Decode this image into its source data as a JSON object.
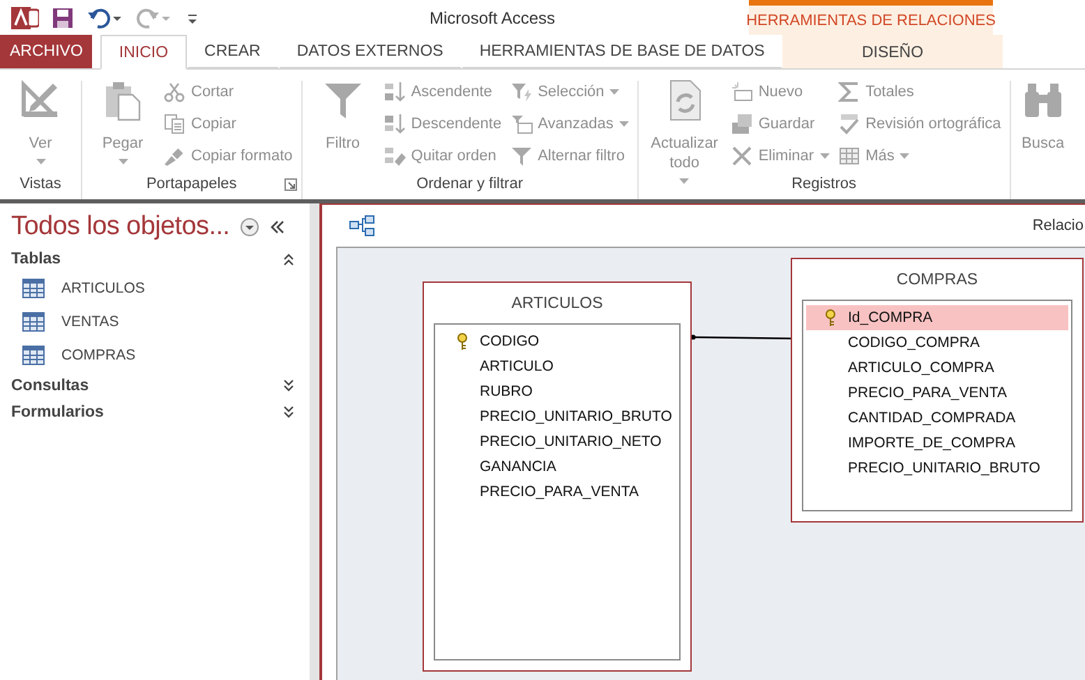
{
  "window": {
    "title": "Microsoft Access",
    "context_header": "HERRAMIENTAS DE RELACIONES"
  },
  "tabs": [
    {
      "label": "ARCHIVO",
      "kind": "file",
      "selected": false
    },
    {
      "label": "INICIO",
      "kind": "tab",
      "selected": true
    },
    {
      "label": "CREAR",
      "kind": "tab",
      "selected": false
    },
    {
      "label": "DATOS EXTERNOS",
      "kind": "tab",
      "selected": false
    },
    {
      "label": "HERRAMIENTAS DE BASE DE DATOS",
      "kind": "tab",
      "selected": false
    },
    {
      "label": "DISEÑO",
      "kind": "contextual",
      "selected": false
    }
  ],
  "ribbon": {
    "groups": [
      {
        "label": "Vistas",
        "launcher": false,
        "columns": [
          {
            "kind": "large",
            "buttons": [
              {
                "label": "Ver",
                "dropdown": true,
                "disabled": true
              }
            ]
          }
        ]
      },
      {
        "label": "Portapapeles",
        "launcher": true,
        "columns": [
          {
            "kind": "large",
            "buttons": [
              {
                "label": "Pegar",
                "dropdown": true,
                "disabled": true
              }
            ]
          },
          {
            "kind": "small",
            "buttons": [
              {
                "label": "Cortar",
                "dropdown": false,
                "disabled": true
              },
              {
                "label": "Copiar",
                "dropdown": false,
                "disabled": true
              },
              {
                "label": "Copiar formato",
                "dropdown": false,
                "disabled": true
              }
            ]
          }
        ]
      },
      {
        "label": "Ordenar y filtrar",
        "launcher": false,
        "columns": [
          {
            "kind": "large",
            "buttons": [
              {
                "label": "Filtro",
                "dropdown": false,
                "disabled": true
              }
            ]
          },
          {
            "kind": "small",
            "buttons": [
              {
                "label": "Ascendente",
                "dropdown": false,
                "disabled": true
              },
              {
                "label": "Descendente",
                "dropdown": false,
                "disabled": true
              },
              {
                "label": "Quitar orden",
                "dropdown": false,
                "disabled": true
              }
            ]
          },
          {
            "kind": "small",
            "buttons": [
              {
                "label": "Selección",
                "dropdown": true,
                "disabled": true
              },
              {
                "label": "Avanzadas",
                "dropdown": true,
                "disabled": true
              },
              {
                "label": "Alternar filtro",
                "dropdown": false,
                "disabled": true
              }
            ]
          }
        ]
      },
      {
        "label": "Registros",
        "launcher": false,
        "columns": [
          {
            "kind": "large",
            "buttons": [
              {
                "label": "Actualizar todo",
                "dropdown": true,
                "disabled": true
              }
            ]
          },
          {
            "kind": "small",
            "buttons": [
              {
                "label": "Nuevo",
                "dropdown": false,
                "disabled": true
              },
              {
                "label": "Guardar",
                "dropdown": false,
                "disabled": true
              },
              {
                "label": "Eliminar",
                "dropdown": true,
                "disabled": true
              }
            ]
          },
          {
            "kind": "small",
            "buttons": [
              {
                "label": "Totales",
                "dropdown": false,
                "disabled": true
              },
              {
                "label": "Revisión ortográfica",
                "dropdown": false,
                "disabled": true
              },
              {
                "label": "Más",
                "dropdown": true,
                "disabled": true
              }
            ]
          }
        ]
      },
      {
        "columns": [
          {
            "kind": "large",
            "buttons": [
              {
                "label": "Busca",
                "dropdown": false,
                "disabled": true
              }
            ]
          }
        ]
      }
    ]
  },
  "navigation": {
    "title": "Todos los objetos...",
    "groups": [
      {
        "label": "Tablas",
        "expanded": true,
        "items": [
          {
            "label": "ARTICULOS"
          },
          {
            "label": "VENTAS"
          },
          {
            "label": "COMPRAS"
          }
        ]
      },
      {
        "label": "Consultas",
        "expanded": false
      },
      {
        "label": "Formularios",
        "expanded": false
      }
    ]
  },
  "document": {
    "tab_label": "Relacio",
    "tables": [
      {
        "name": "ARTICULOS",
        "fields": [
          {
            "name": "CODIGO",
            "key": true,
            "selected": false
          },
          {
            "name": "ARTICULO",
            "key": false,
            "selected": false
          },
          {
            "name": "RUBRO",
            "key": false,
            "selected": false
          },
          {
            "name": "PRECIO_UNITARIO_BRUTO",
            "key": false,
            "selected": false
          },
          {
            "name": "PRECIO_UNITARIO_NETO",
            "key": false,
            "selected": false
          },
          {
            "name": "GANANCIA",
            "key": false,
            "selected": false
          },
          {
            "name": "PRECIO_PARA_VENTA",
            "key": false,
            "selected": false
          }
        ]
      },
      {
        "name": "COMPRAS",
        "fields": [
          {
            "name": "Id_COMPRA",
            "key": true,
            "selected": true
          },
          {
            "name": "CODIGO_COMPRA",
            "key": false,
            "selected": false
          },
          {
            "name": "ARTICULO_COMPRA",
            "key": false,
            "selected": false
          },
          {
            "name": "PRECIO_PARA_VENTA",
            "key": false,
            "selected": false
          },
          {
            "name": "CANTIDAD_COMPRADA",
            "key": false,
            "selected": false
          },
          {
            "name": "IMPORTE_DE_COMPRA",
            "key": false,
            "selected": false
          },
          {
            "name": "PRECIO_UNITARIO_BRUTO",
            "key": false,
            "selected": false
          }
        ]
      }
    ]
  }
}
